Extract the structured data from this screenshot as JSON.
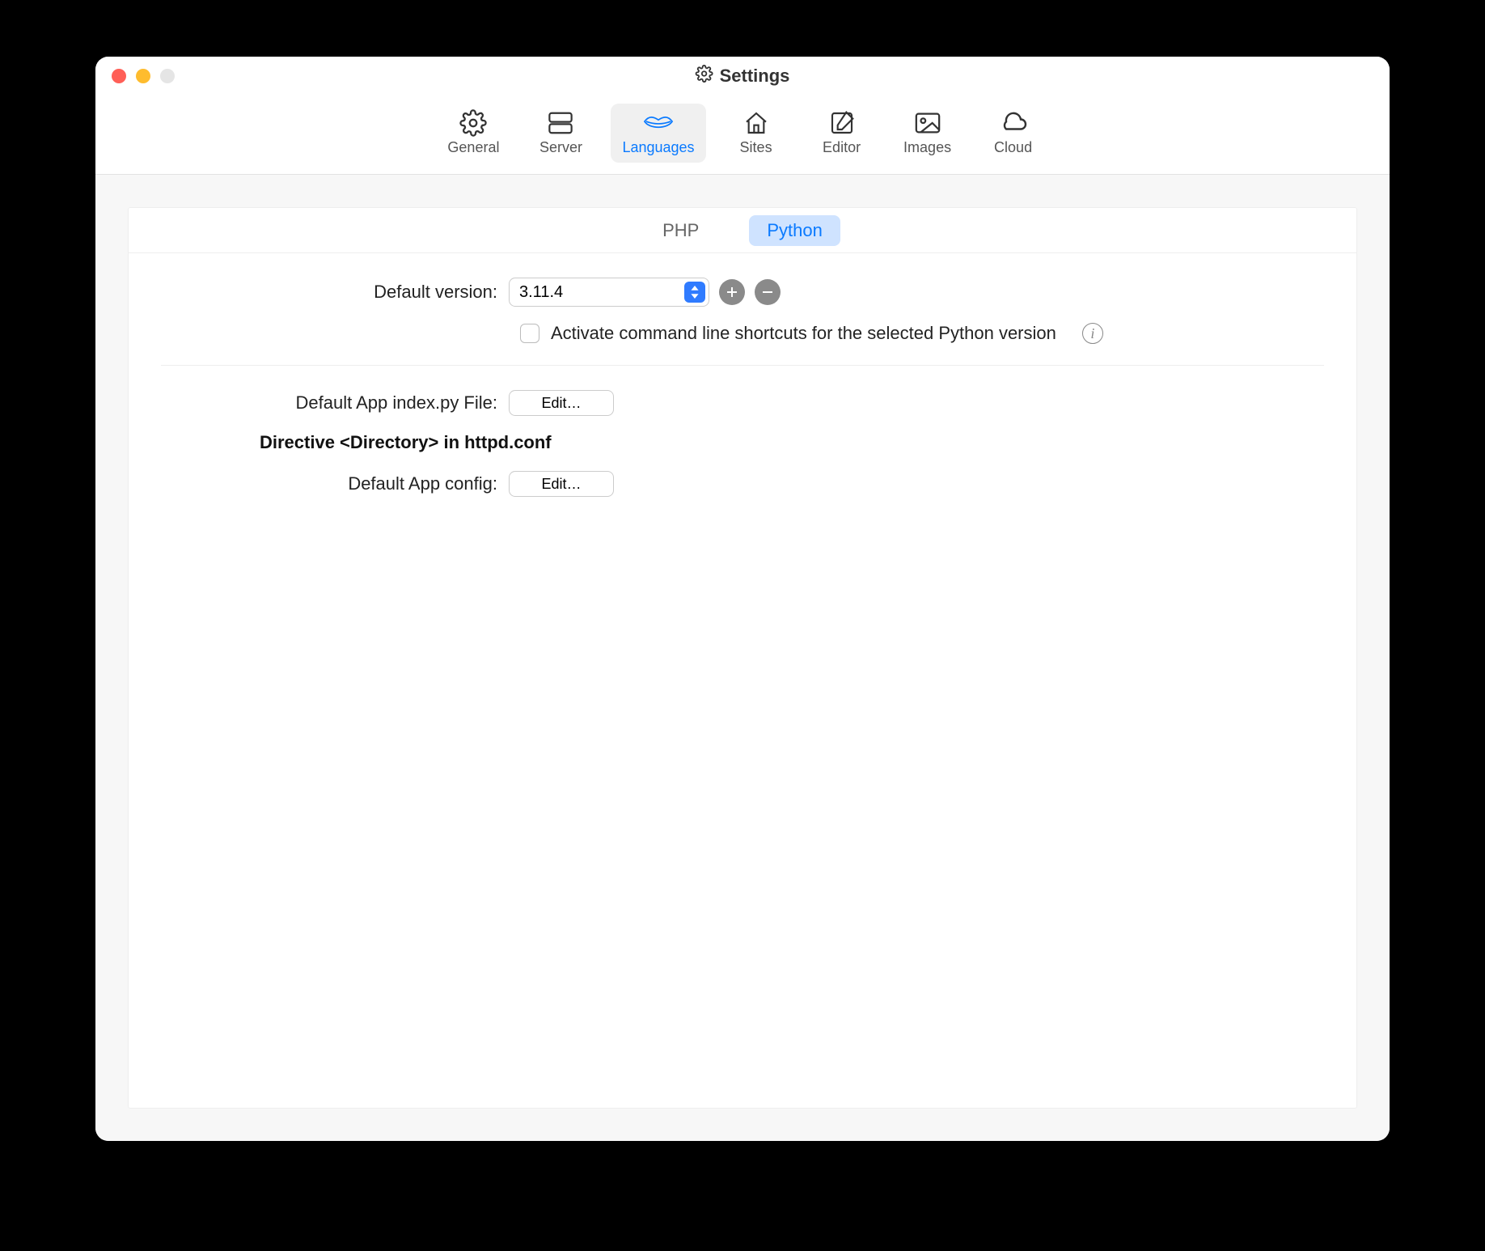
{
  "window": {
    "title": "Settings"
  },
  "toolbar": {
    "items": [
      {
        "label": "General"
      },
      {
        "label": "Server"
      },
      {
        "label": "Languages"
      },
      {
        "label": "Sites"
      },
      {
        "label": "Editor"
      },
      {
        "label": "Images"
      },
      {
        "label": "Cloud"
      }
    ],
    "selectedIndex": 2
  },
  "subtabs": {
    "items": [
      "PHP",
      "Python"
    ],
    "activeIndex": 1
  },
  "form": {
    "defaultVersionLabel": "Default version:",
    "defaultVersionValue": "3.11.4",
    "activateShortcutsLabel": "Activate command line shortcuts for the selected Python version",
    "defaultAppIndexLabel": "Default App index.py File:",
    "editButtonLabel": "Edit…",
    "directiveHeading": "Directive <Directory> in httpd.conf",
    "defaultAppConfigLabel": "Default App config:"
  }
}
